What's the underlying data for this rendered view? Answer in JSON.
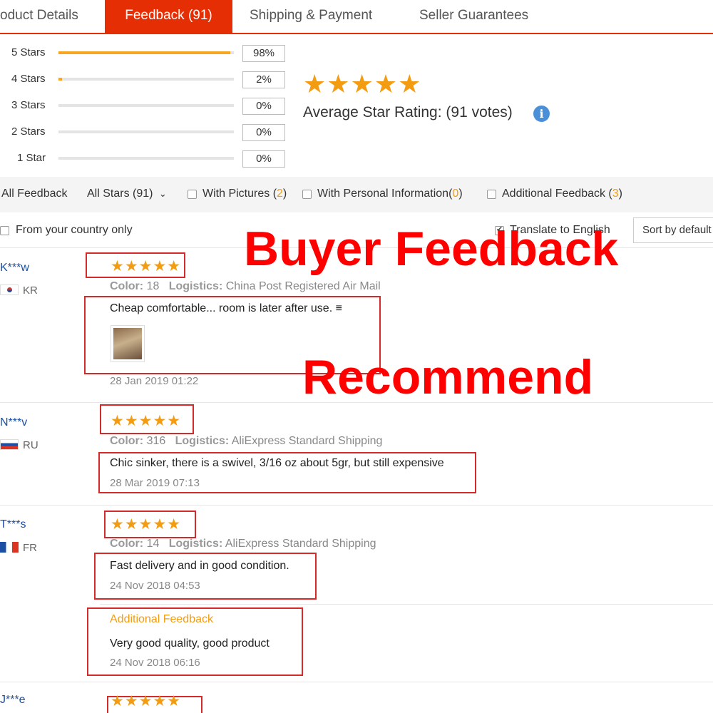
{
  "tabs": [
    {
      "label": "oduct Details"
    },
    {
      "label": "Feedback (91)"
    },
    {
      "label": "Shipping & Payment"
    },
    {
      "label": "Seller Guarantees"
    }
  ],
  "histogram": [
    {
      "label": "5 Stars",
      "percent": "98%",
      "value": 98
    },
    {
      "label": "4 Stars",
      "percent": "2%",
      "value": 2
    },
    {
      "label": "3 Stars",
      "percent": "0%",
      "value": 0
    },
    {
      "label": "2 Stars",
      "percent": "0%",
      "value": 0
    },
    {
      "label": "1 Star",
      "percent": "0%",
      "value": 0
    }
  ],
  "summary": {
    "stars": "★★★★★",
    "label": "Average Star Rating:",
    "votes": "(91 votes)",
    "info_glyph": "i"
  },
  "filters": {
    "all_feedback": "All Feedback",
    "all_stars": "All Stars (91)",
    "dropdown_glyph": "⌄",
    "with_pictures": "With Pictures (",
    "with_pictures_count": "2",
    "personal_info": "With Personal Information(",
    "personal_info_count": "0",
    "additional": "Additional Feedback (",
    "additional_count": "3",
    "close_paren": ")",
    "country_only": "From your country only",
    "translate": "Translate to English",
    "sort": "Sort by default"
  },
  "overlay": {
    "title": "Buyer Feedback",
    "subtitle": "Recommend"
  },
  "reviews": [
    {
      "buyer": "K***w",
      "country": "KR",
      "stars": "★★★★★",
      "color_label": "Color:",
      "color": "18",
      "logistics_label": "Logistics:",
      "logistics": "China Post Registered Air Mail",
      "text": "Cheap comfortable... room is later after use. ≡",
      "date": "28 Jan 2019 01:22"
    },
    {
      "buyer": "N***v",
      "country": "RU",
      "stars": "★★★★★",
      "color_label": "Color:",
      "color": "316",
      "logistics_label": "Logistics:",
      "logistics": "AliExpress Standard Shipping",
      "text": "Chic sinker, there is a swivel, 3/16 oz about 5gr, but still expensive",
      "date": "28 Mar 2019 07:13"
    },
    {
      "buyer": "T***s",
      "country": "FR",
      "stars": "★★★★★",
      "color_label": "Color:",
      "color": "14",
      "logistics_label": "Logistics:",
      "logistics": "AliExpress Standard Shipping",
      "text": "Fast delivery and in good condition.",
      "date": "24 Nov 2018 04:53",
      "additional_label": "Additional Feedback",
      "additional_text": "Very good quality, good product",
      "additional_date": "24 Nov 2018 06:16"
    },
    {
      "buyer": "J***e",
      "stars": "★★★★★"
    }
  ],
  "colors": {
    "accent": "#e62e04",
    "star": "#f39c12",
    "annotation": "#ff0000",
    "buyer_link": "#1a4fa3"
  }
}
